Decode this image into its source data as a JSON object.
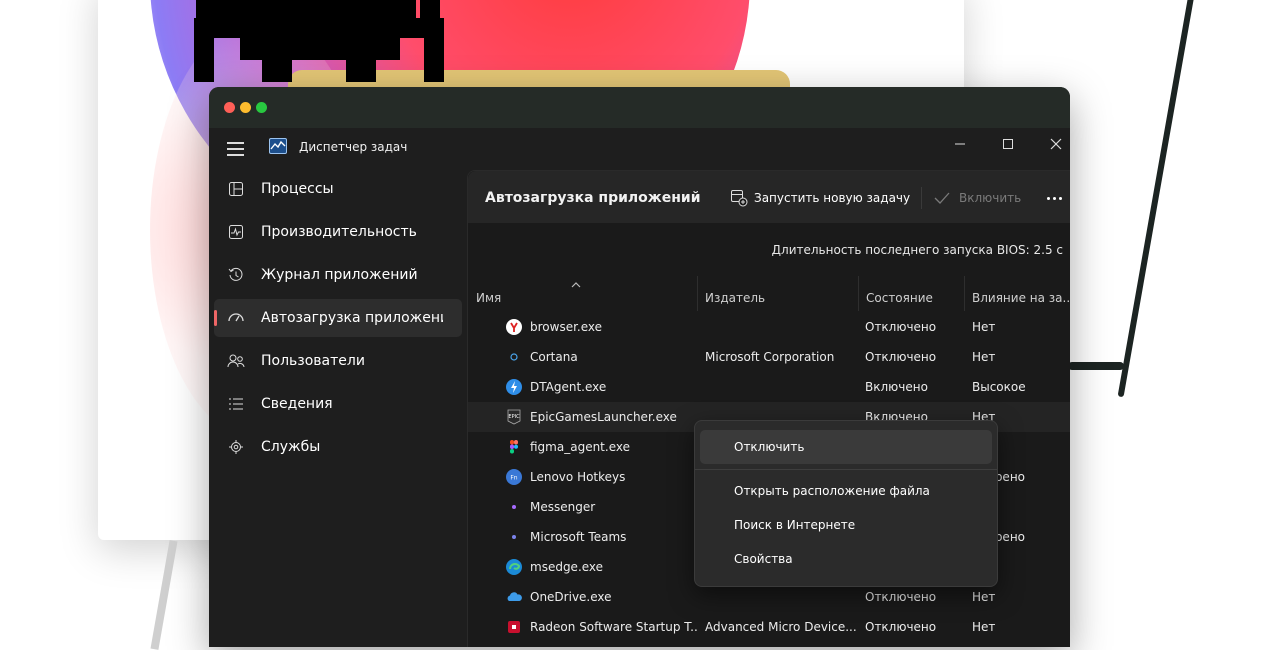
{
  "window": {
    "app_title": "Диспетчер задач"
  },
  "sidebar": {
    "items": [
      {
        "label": "Процессы",
        "icon": "processes-icon"
      },
      {
        "label": "Производительность",
        "icon": "performance-icon"
      },
      {
        "label": "Журнал приложений",
        "icon": "app-history-icon"
      },
      {
        "label": "Автозагрузка приложений",
        "icon": "startup-apps-icon",
        "active": true
      },
      {
        "label": "Пользователи",
        "icon": "users-icon"
      },
      {
        "label": "Сведения",
        "icon": "details-icon"
      },
      {
        "label": "Службы",
        "icon": "services-icon"
      }
    ]
  },
  "toolbar": {
    "page_title": "Автозагрузка приложений",
    "run_task_label": "Запустить новую задачу",
    "enable_label": "Включить"
  },
  "bios": {
    "text": "Длительность последнего запуска BIOS: 2.5 с"
  },
  "table": {
    "columns": [
      "Имя",
      "Издатель",
      "Состояние",
      "Влияние на за..."
    ],
    "rows": [
      {
        "name": "browser.exe",
        "publisher": "",
        "state": "Отключено",
        "impact": "Нет",
        "icon": "yandex-browser-icon"
      },
      {
        "name": "Cortana",
        "publisher": "Microsoft Corporation",
        "state": "Отключено",
        "impact": "Нет",
        "icon": "cortana-icon"
      },
      {
        "name": "DTAgent.exe",
        "publisher": "",
        "state": "Включено",
        "impact": "Высокое",
        "icon": "dtagent-icon"
      },
      {
        "name": "EpicGamesLauncher.exe",
        "publisher": "",
        "state": "Включено",
        "impact": "Нет",
        "icon": "epic-games-icon"
      },
      {
        "name": "figma_agent.exe",
        "publisher": "",
        "state": "",
        "impact": "",
        "icon": "figma-icon"
      },
      {
        "name": "Lenovo Hotkeys",
        "publisher": "",
        "state": "",
        "impact": "змерено",
        "icon": "lenovo-hotkeys-icon"
      },
      {
        "name": "Messenger",
        "publisher": "",
        "state": "",
        "impact": "",
        "icon": "messenger-icon"
      },
      {
        "name": "Microsoft Teams",
        "publisher": "",
        "state": "",
        "impact": "змерено",
        "icon": "teams-icon"
      },
      {
        "name": "msedge.exe",
        "publisher": "",
        "state": "",
        "impact": "",
        "icon": "edge-icon"
      },
      {
        "name": "OneDrive.exe",
        "publisher": "",
        "state": "Отключено",
        "impact": "Нет",
        "icon": "onedrive-icon"
      },
      {
        "name": "Radeon Software Startup T...",
        "publisher": "Advanced Micro Device...",
        "state": "Отключено",
        "impact": "Нет",
        "icon": "radeon-icon"
      }
    ]
  },
  "context_menu": {
    "items": [
      "Отключить",
      "Открыть расположение файла",
      "Поиск в Интернете",
      "Свойства"
    ]
  },
  "colors": {
    "accent": "#ee6666",
    "window_bg": "#1e1e1e",
    "mac_red": "#fe5f57",
    "mac_yellow": "#febc2e",
    "mac_green": "#28c840"
  }
}
